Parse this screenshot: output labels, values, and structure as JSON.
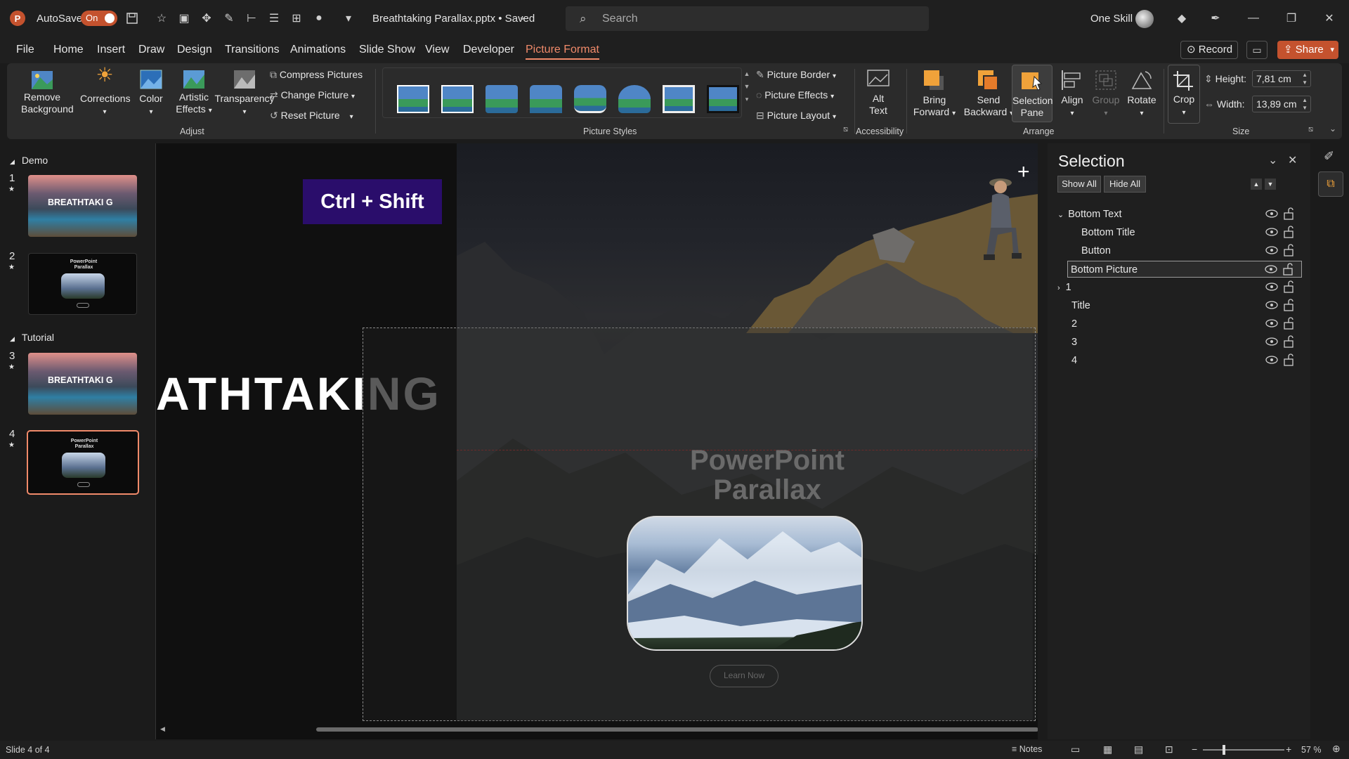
{
  "titlebar": {
    "autosave_label": "AutoSave",
    "autosave_state": "On",
    "file_name": "Breathtaking Parallax.pptx • Saved",
    "search_placeholder": "Search",
    "user_name": "One Skill"
  },
  "menu": [
    "File",
    "Home",
    "Insert",
    "Draw",
    "Design",
    "Transitions",
    "Animations",
    "Slide Show",
    "View",
    "Developer",
    "Picture Format"
  ],
  "menu_active": "Picture Format",
  "actions": {
    "record": "Record",
    "share": "Share"
  },
  "ribbon": {
    "adjust": {
      "remove_bg": [
        "Remove",
        "Background"
      ],
      "corrections": "Corrections",
      "color": "Color",
      "artistic": [
        "Artistic",
        "Effects"
      ],
      "transparency": "Transparency",
      "compress": "Compress Pictures",
      "change": "Change Picture",
      "reset": "Reset Picture",
      "group_label": "Adjust"
    },
    "styles": {
      "group_label": "Picture Styles",
      "border": "Picture Border",
      "effects": "Picture Effects",
      "layout": "Picture Layout"
    },
    "accessibility": {
      "alt_text": [
        "Alt",
        "Text"
      ],
      "group_label": "Accessibility"
    },
    "arrange": {
      "bring_forward": [
        "Bring",
        "Forward"
      ],
      "send_backward": [
        "Send",
        "Backward"
      ],
      "selection_pane": [
        "Selection",
        "Pane"
      ],
      "align": "Align",
      "group": "Group",
      "rotate": "Rotate",
      "group_label": "Arrange"
    },
    "size": {
      "crop": "Crop",
      "height_label": "Height:",
      "height_value": "7,81 cm",
      "width_label": "Width:",
      "width_value": "13,89 cm",
      "group_label": "Size"
    }
  },
  "thumbnails": {
    "sections": [
      "Demo",
      "Tutorial"
    ],
    "slides": [
      {
        "num": "1",
        "title": "BREATHTAKI G"
      },
      {
        "num": "2",
        "title": "PowerPoint Parallax"
      },
      {
        "num": "3",
        "title": "BREATHTAKI G"
      },
      {
        "num": "4",
        "title": "PowerPoint Parallax"
      }
    ]
  },
  "canvas": {
    "shortcut_badge": "Ctrl + Shift",
    "big_title_visible": "ATHTAKI",
    "big_title_fade": "NG",
    "card_title_line1": "PowerPoint",
    "card_title_line2": "Parallax",
    "card_button": "Learn Now"
  },
  "selection_pane": {
    "title": "Selection",
    "show_all": "Show All",
    "hide_all": "Hide All",
    "items": [
      {
        "label": "Bottom Text",
        "expanded": true
      },
      {
        "label": "Bottom Title"
      },
      {
        "label": "Button"
      },
      {
        "label": "Bottom Picture",
        "selected": true
      },
      {
        "label": "1",
        "expanded": false
      },
      {
        "label": "Title"
      },
      {
        "label": "2"
      },
      {
        "label": "3"
      },
      {
        "label": "4"
      }
    ]
  },
  "statusbar": {
    "slide_info": "Slide 4 of 4",
    "notes": "Notes",
    "zoom": "57 %"
  },
  "colors": {
    "accent": "#f08a6a",
    "share": "#c4522e",
    "badge": "#2a0d6b",
    "toggle": "#c4522e"
  }
}
